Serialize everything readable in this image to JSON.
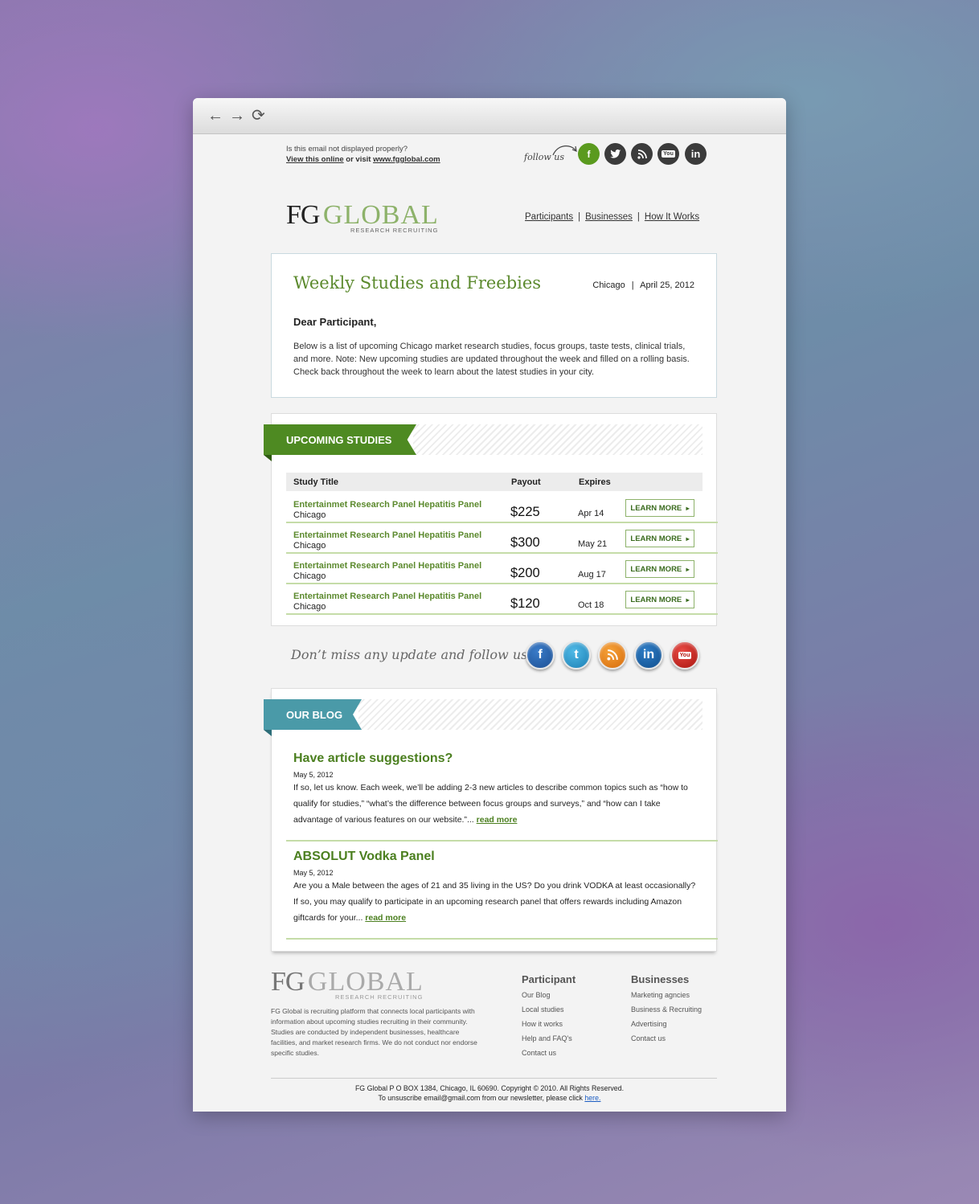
{
  "browser": {
    "back_icon": "arrow-left-icon",
    "forward_icon": "arrow-right-icon",
    "reload_icon": "reload-icon"
  },
  "topbar": {
    "notice": "Is this email not displayed properly?",
    "view_online": "View this online",
    "or_visit": "or visit",
    "site": "www.fgglobal.com",
    "follow_us": "follow us",
    "social_icons": [
      "facebook-icon",
      "twitter-icon",
      "rss-icon",
      "youtube-icon",
      "linkedin-icon"
    ],
    "social_colors": {
      "facebook": "#5a9a1e",
      "other": "#3b3b3b"
    }
  },
  "logo": {
    "fg": "FG",
    "global": "GLOBAL",
    "tagline": "RESEARCH RECRUITING"
  },
  "nav": [
    "Participants",
    "Businesses",
    "How It Works"
  ],
  "intro": {
    "title": "Weekly Studies and Freebies",
    "city": "Chicago",
    "date": "April 25, 2012",
    "greeting": "Dear Participant,",
    "body": "Below is a list of upcoming Chicago market research studies, focus groups, taste tests, clinical trials, and more. Note: New upcoming studies are updated throughout the week and filled on a rolling basis. Check back throughout the week to learn about the latest studies in your city."
  },
  "studies": {
    "section_title": "UPCOMING STUDIES",
    "headers": {
      "title": "Study Title",
      "payout": "Payout",
      "expires": "Expires"
    },
    "rows": [
      {
        "title": "Entertainmet Research Panel Hepatitis Panel",
        "city": "Chicago",
        "payout": "$225",
        "expires": "Apr 14",
        "button": "LEARN MORE"
      },
      {
        "title": "Entertainmet Research Panel Hepatitis Panel",
        "city": "Chicago",
        "payout": "$300",
        "expires": "May 21",
        "button": "LEARN MORE"
      },
      {
        "title": "Entertainmet Research Panel Hepatitis Panel",
        "city": "Chicago",
        "payout": "$200",
        "expires": "Aug 17",
        "button": "LEARN MORE"
      },
      {
        "title": "Entertainmet Research Panel Hepatitis Panel",
        "city": "Chicago",
        "payout": "$120",
        "expires": "Oct 18",
        "button": "LEARN MORE"
      }
    ],
    "accent_color": "#4e8a22"
  },
  "follow_banner": {
    "text": "Don’t miss any update and follow us!",
    "icons": [
      "facebook-icon",
      "twitter-icon",
      "rss-icon",
      "linkedin-icon",
      "youtube-icon"
    ]
  },
  "blog": {
    "section_title": "OUR BLOG",
    "accent_color": "#4a9aa8",
    "posts": [
      {
        "title": "Have article suggestions?",
        "date": "May 5, 2012",
        "text": "If so, let us know. Each week, we’ll be adding 2-3 new articles to describe common topics such as “how to qualify for studies,” “what’s the difference between focus groups and surveys,” and “how can I take advantage of various features on our website.”...",
        "read_more": "read more"
      },
      {
        "title": "ABSOLUT Vodka Panel",
        "date": "May 5, 2012",
        "text": "Are you a Male between the ages of 21 and 35 living in the US? Do you drink VODKA at least occasionally? If so, you may qualify to participate in an upcoming research panel that offers rewards including Amazon giftcards for your...",
        "read_more": "read more"
      }
    ]
  },
  "footer": {
    "about": "FG Global is recruiting platform that connects local participants with information about upcoming studies recruiting in their community. Studies are conducted by independent businesses, healthcare facilities, and market research firms. We do not conduct nor endorse specific studies.",
    "participant": {
      "heading": "Participant",
      "links": [
        "Our Blog",
        "Local studies",
        "How it works",
        "Help and FAQ's",
        "Contact us"
      ]
    },
    "businesses": {
      "heading": "Businesses",
      "links": [
        "Marketing agncies",
        "Business & Recruiting",
        "Advertising",
        "Contact us"
      ]
    },
    "address": "FG Global P O BOX 1384, Chicago, IL 60690. Copyright © 2010. All Rights Reserved.",
    "unsubscribe": "To unsuscribe email@gmail.com from our newsletter, please click",
    "here": "here."
  }
}
